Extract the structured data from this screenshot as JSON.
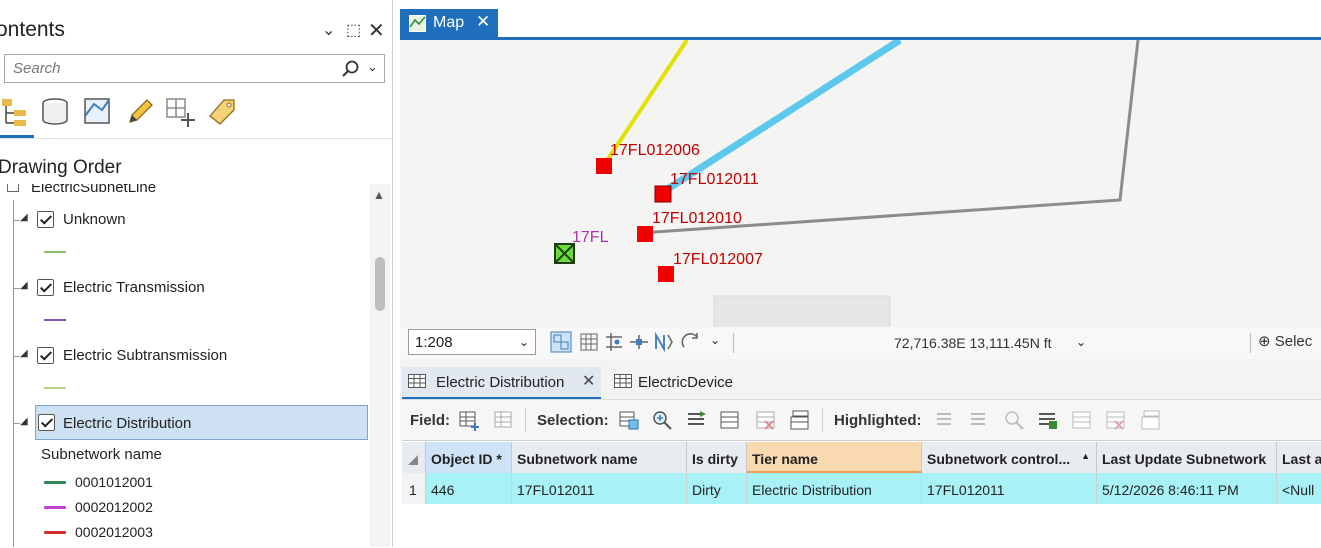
{
  "contents": {
    "title": "ontents",
    "search_placeholder": "Search",
    "drawing_order": "Drawing Order",
    "partial_layer": "ElectricSubnetLine",
    "layers": [
      {
        "label": "Unknown",
        "color": "#8fbf6a"
      },
      {
        "label": "Electric Transmission",
        "color": "#7e57b8"
      },
      {
        "label": "Electric Subtransmission",
        "color": "#bcd28a"
      },
      {
        "label": "Electric Distribution",
        "color": ""
      }
    ],
    "subnetwork_heading": "Subnetwork name",
    "subnetworks": [
      {
        "name": "0001012001",
        "color": "#2e8b57"
      },
      {
        "name": "0002012002",
        "color": "#c040d0"
      },
      {
        "name": "0002012003",
        "color": "#d03030"
      }
    ]
  },
  "map": {
    "tab_label": "Map",
    "labels": {
      "l1": "17FL012006",
      "l2": "17FL012011",
      "l3": "17FL012010",
      "l4": "17FL012007",
      "l5": "17FL"
    },
    "scale": "1:208",
    "coordinates": "72,716.38E 13,111.45N ft",
    "select_label": "Selec"
  },
  "table": {
    "tabs": [
      "Electric Distribution",
      "ElectricDevice"
    ],
    "toolbar": {
      "field": "Field:",
      "selection": "Selection:",
      "highlighted": "Highlighted:"
    },
    "columns": [
      "Object ID *",
      "Subnetwork name",
      "Is dirty",
      "Tier name",
      "Subnetwork control...",
      "Last Update Subnetwork",
      "Last a"
    ],
    "rows": [
      {
        "num": "1",
        "cells": [
          "446",
          "17FL012011",
          "Dirty",
          "Electric Distribution",
          "17FL012011",
          "5/12/2026 8:46:11 PM",
          "<Null"
        ]
      }
    ]
  }
}
